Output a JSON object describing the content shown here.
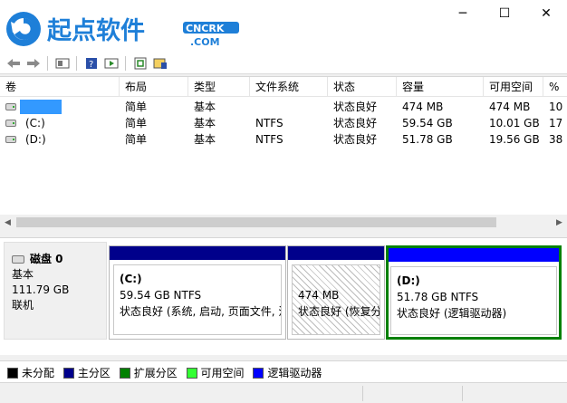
{
  "branding": {
    "logo_text": "起点软件",
    "logo_domain_top": "CNCRK",
    "logo_domain_bottom": ".COM"
  },
  "window": {
    "minimize_glyph": "─",
    "maximize_glyph": "☐",
    "close_glyph": "✕"
  },
  "toolbar": {
    "icons": [
      "back-icon",
      "forward-icon",
      "up-icon",
      "help-icon",
      "console-icon",
      "refresh-icon",
      "properties-icon"
    ]
  },
  "volume_table": {
    "columns": [
      "卷",
      "布局",
      "类型",
      "文件系统",
      "状态",
      "容量",
      "可用空间",
      "%"
    ],
    "rows": [
      {
        "volume": "",
        "layout": "简单",
        "type": "基本",
        "fs": "",
        "status": "状态良好",
        "capacity": "474 MB",
        "free": "474 MB",
        "pct": "10"
      },
      {
        "volume": "(C:)",
        "layout": "简单",
        "type": "基本",
        "fs": "NTFS",
        "status": "状态良好",
        "capacity": "59.54 GB",
        "free": "10.01 GB",
        "pct": "17"
      },
      {
        "volume": "(D:)",
        "layout": "简单",
        "type": "基本",
        "fs": "NTFS",
        "status": "状态良好",
        "capacity": "51.78 GB",
        "free": "19.56 GB",
        "pct": "38"
      }
    ]
  },
  "disk": {
    "name": "磁盘 0",
    "type": "基本",
    "size": "111.79 GB",
    "state": "联机",
    "partitions": [
      {
        "name": "(C:)",
        "size_fs": "59.54 GB NTFS",
        "status": "状态良好 (系统, 启动, 页面文件, 活"
      },
      {
        "name": "",
        "size_fs": "474 MB",
        "status": "状态良好 (恢复分"
      },
      {
        "name": "(D:)",
        "size_fs": "51.78 GB NTFS",
        "status": "状态良好 (逻辑驱动器)"
      }
    ]
  },
  "legend": {
    "items": [
      {
        "label": "未分配",
        "color": "#000000"
      },
      {
        "label": "主分区",
        "color": "#00008b"
      },
      {
        "label": "扩展分区",
        "color": "#008000"
      },
      {
        "label": "可用空间",
        "color": "#33ff33"
      },
      {
        "label": "逻辑驱动器",
        "color": "#0000ff"
      }
    ]
  },
  "colors": {
    "primary_partition": "#00008b",
    "logical_drive": "#0000ff",
    "extended_partition": "#008000",
    "selection": "#3399ff",
    "logo_blue": "#1e7fd8"
  }
}
